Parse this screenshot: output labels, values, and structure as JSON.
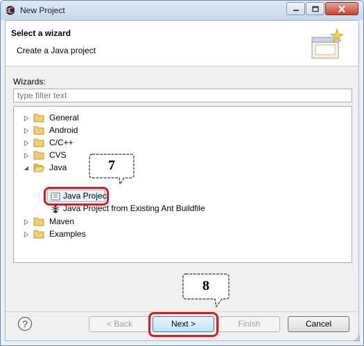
{
  "window": {
    "title": "New Project"
  },
  "banner": {
    "title": "Select a wizard",
    "description": "Create a Java project",
    "icon": "wizard-banner-icon"
  },
  "wizards_label": "Wizards:",
  "filter": {
    "placeholder": "type filter text",
    "value": ""
  },
  "tree": {
    "items": [
      {
        "label": "General",
        "expanded": false,
        "icon": "folder-icon"
      },
      {
        "label": "Android",
        "expanded": false,
        "icon": "folder-icon"
      },
      {
        "label": "C/C++",
        "expanded": false,
        "icon": "folder-icon"
      },
      {
        "label": "CVS",
        "expanded": false,
        "icon": "folder-icon"
      },
      {
        "label": "Java",
        "expanded": true,
        "icon": "folder-open-icon"
      },
      {
        "label": "Java Project",
        "selected": true,
        "icon": "java-project-icon"
      },
      {
        "label": "Java Project from Existing Ant Buildfile",
        "icon": "ant-icon"
      },
      {
        "label": "Maven",
        "expanded": false,
        "icon": "folder-icon"
      },
      {
        "label": "Examples",
        "expanded": false,
        "icon": "folder-icon"
      }
    ]
  },
  "annotations": {
    "step_7": "7",
    "step_8": "8",
    "highlight_color": "#e3161d"
  },
  "buttons": {
    "help": "?",
    "back": "< Back",
    "next": "Next >",
    "finish": "Finish",
    "cancel": "Cancel"
  }
}
